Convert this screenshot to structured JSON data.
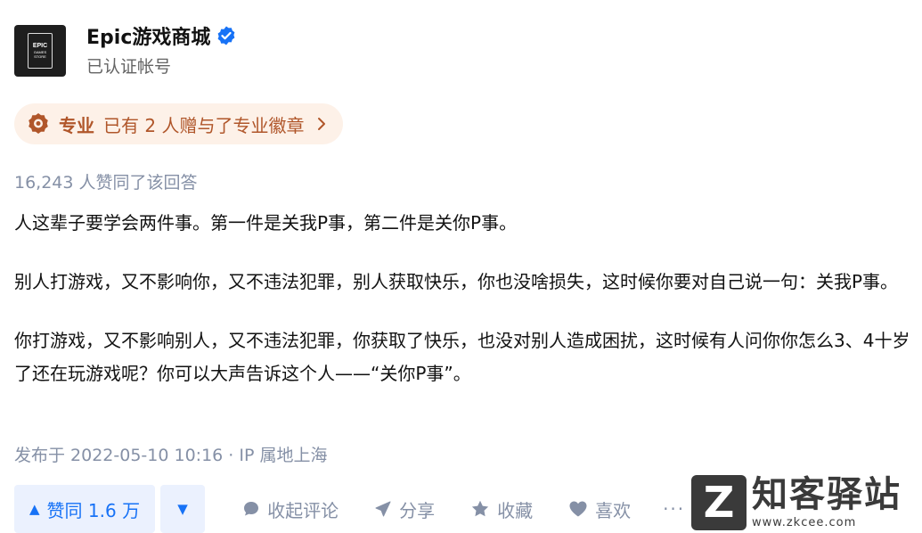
{
  "author": {
    "avatar_line1": "EPIC",
    "avatar_line2": "GAMES",
    "avatar_line3": "STORE",
    "name": "Epic游戏商城",
    "subtitle": "已认证帐号"
  },
  "badge": {
    "label": "专业",
    "text": "已有 2 人赠与了专业徽章"
  },
  "votes_summary": "16,243 人赞同了该回答",
  "content": {
    "paragraphs": [
      "人这辈子要学会两件事。第一件是关我P事，第二件是关你P事。",
      "别人打游戏，又不影响你，又不违法犯罪，别人获取快乐，你也没啥损失，这时候你要对自己说一句：关我P事。",
      "你打游戏，又不影响别人，又不违法犯罪，你获取了快乐，也没对别人造成困扰，这时候有人问你你怎么3、4十岁了还在玩游戏呢？你可以大声告诉这个人——“关你P事”。"
    ]
  },
  "published": "发布于 2022-05-10 10:16 · IP 属地上海",
  "actions": {
    "vote_up_label": "赞同 1.6 万",
    "comment_label": "收起评论",
    "share_label": "分享",
    "collect_label": "收藏",
    "like_label": "喜欢",
    "more_label": "···"
  },
  "watermark": {
    "logo_letter": "Z",
    "title": "知客驿站",
    "url": "www.zkcee.com"
  },
  "colors": {
    "accent_blue": "#1772f6",
    "vote_bg": "#ebf1fe",
    "badge_bg": "#fdf1e8",
    "badge_text": "#b0562a",
    "meta_gray": "#8590a6"
  }
}
